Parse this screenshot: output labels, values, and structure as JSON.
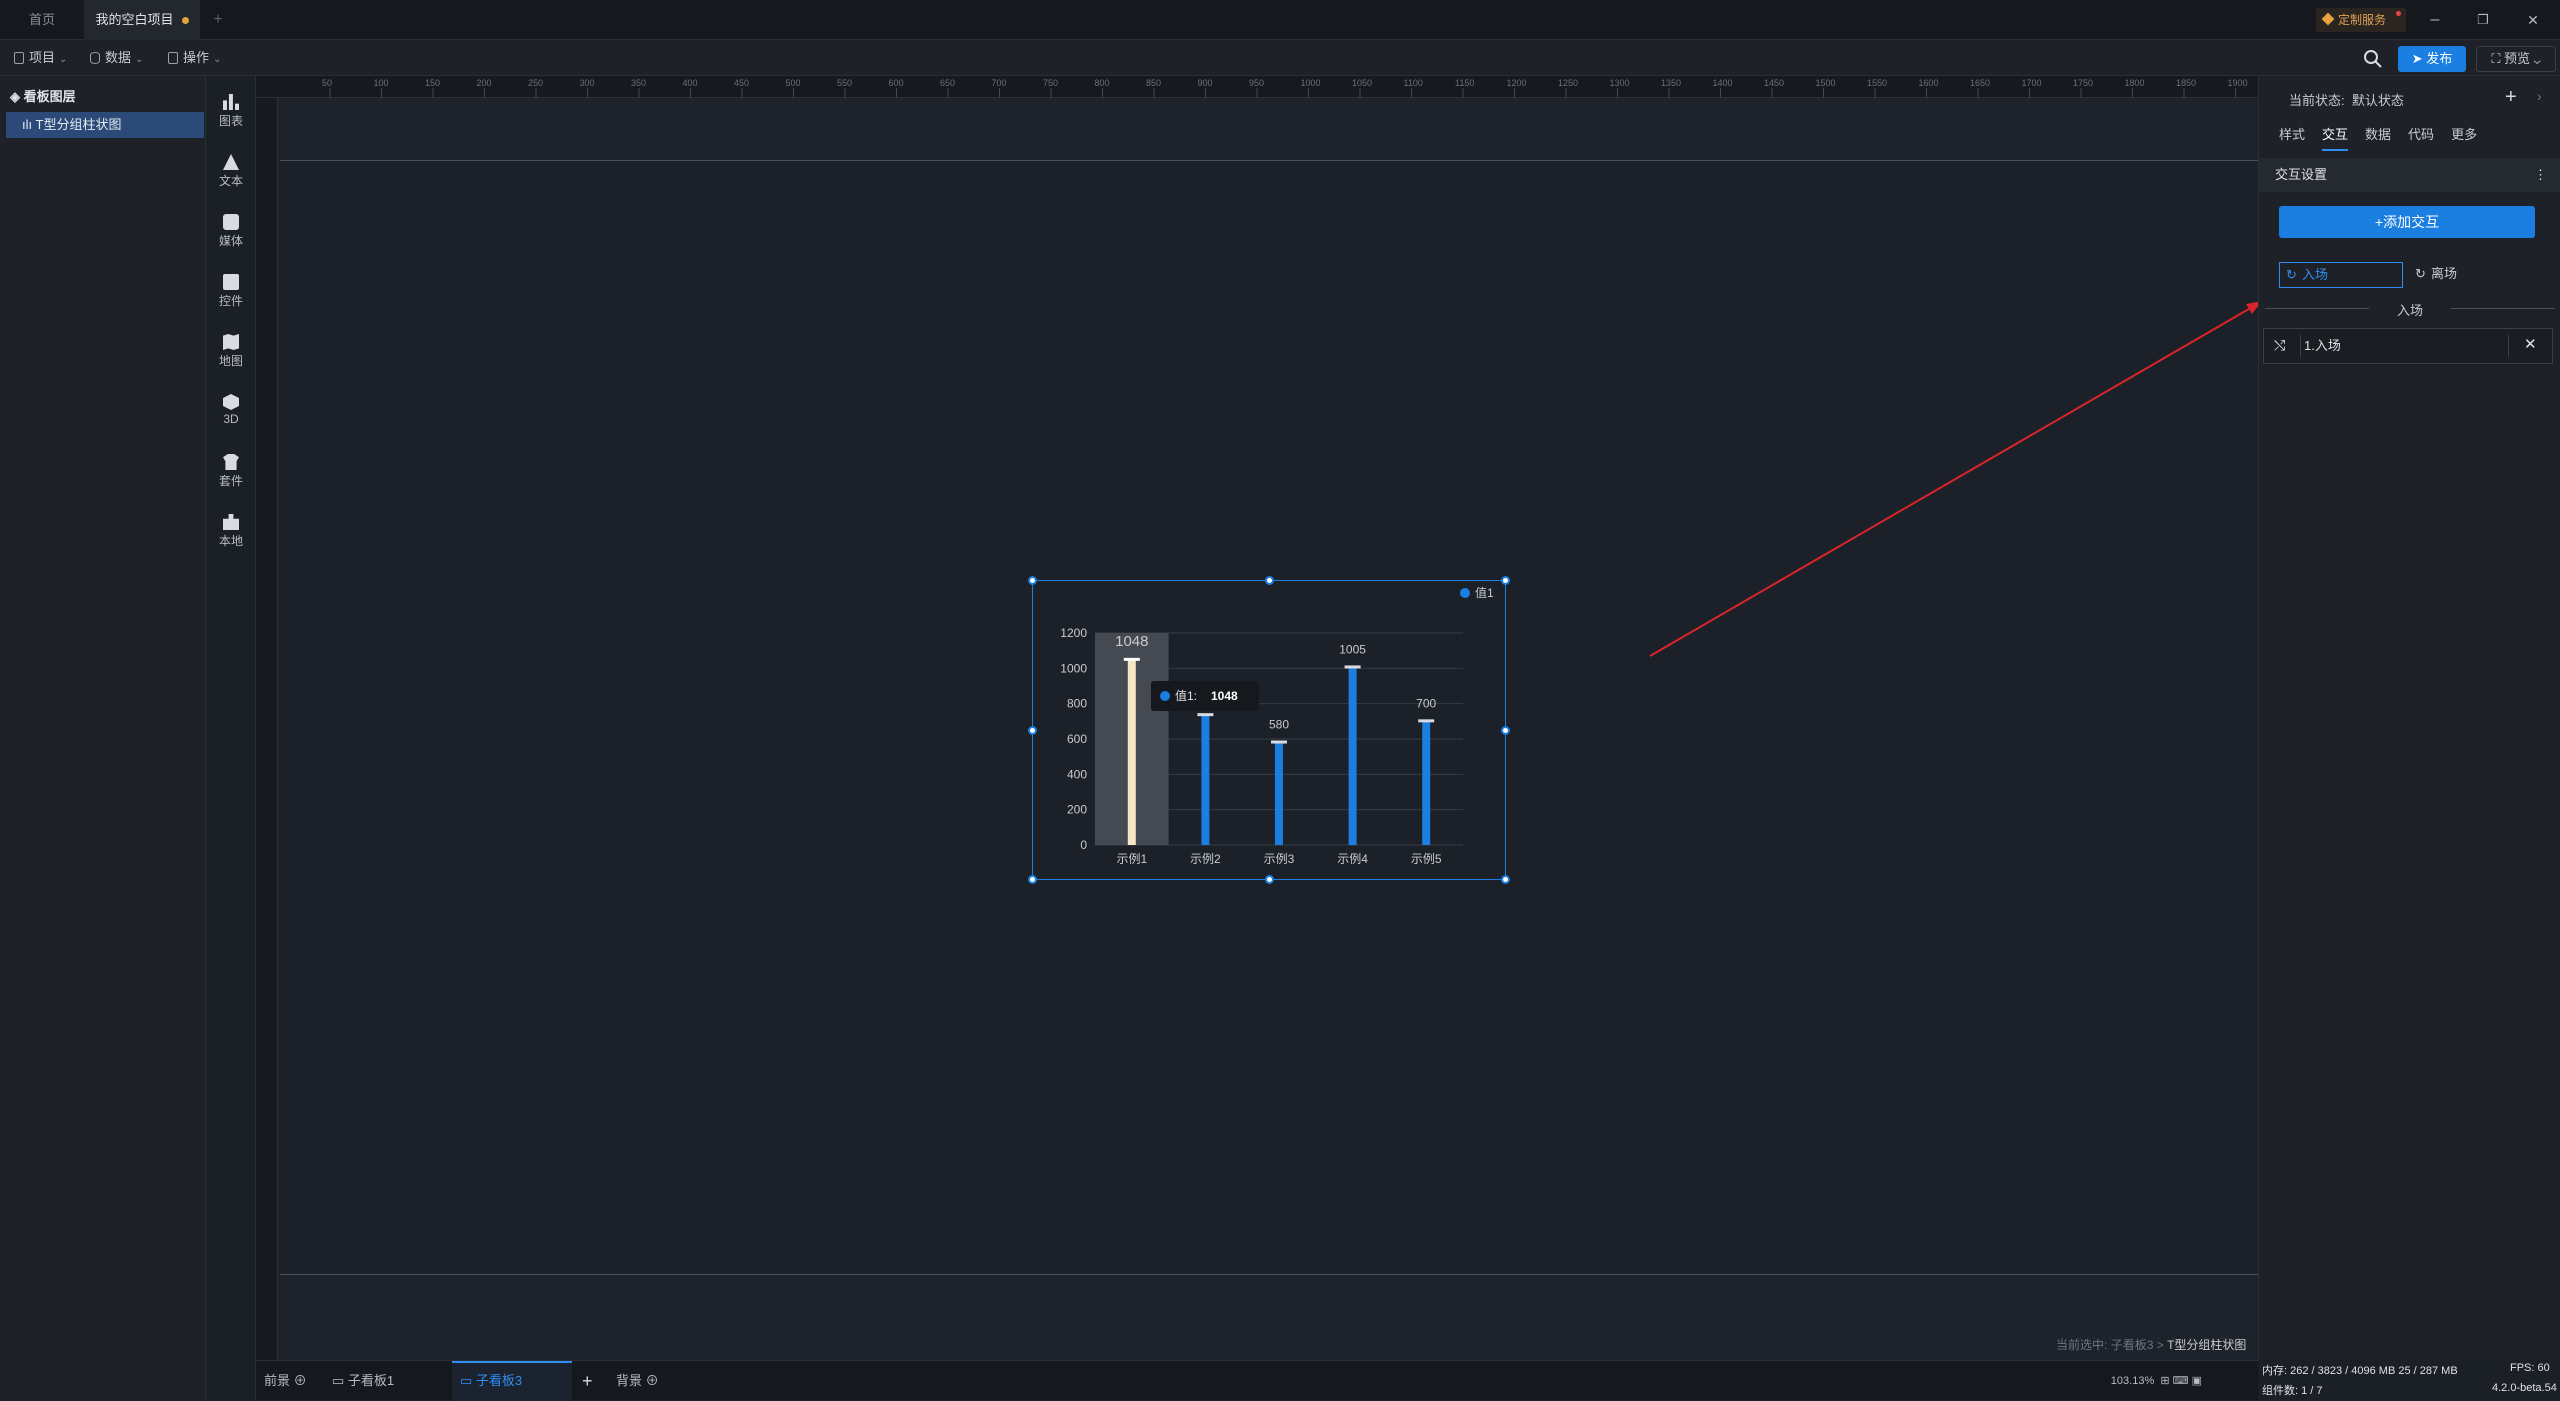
{
  "titlebar": {
    "tab_home": "首页",
    "tab_project": "我的空白项目",
    "tab_add": "+",
    "custom_service": "定制服务",
    "win_min": "–",
    "win_restore": "❐",
    "win_close": "✕"
  },
  "menubar": {
    "project": "项目",
    "data": "数据",
    "operate": "操作",
    "publish": "发布",
    "preview": "预览"
  },
  "layers": {
    "title": "看板图层",
    "items": [
      {
        "label": "T型分组柱状图"
      }
    ]
  },
  "components": [
    {
      "label": "图表",
      "icon": "bar-chart-icon"
    },
    {
      "label": "文本",
      "icon": "text-icon"
    },
    {
      "label": "媒体",
      "icon": "media-icon"
    },
    {
      "label": "控件",
      "icon": "control-icon"
    },
    {
      "label": "地图",
      "icon": "map-icon"
    },
    {
      "label": "3D",
      "icon": "cube-icon"
    },
    {
      "label": "套件",
      "icon": "kit-icon"
    },
    {
      "label": "本地",
      "icon": "puzzle-icon"
    }
  ],
  "ruler": {
    "top_ticks": [
      "50",
      "100",
      "150",
      "200",
      "250",
      "300",
      "350",
      "400",
      "450",
      "500",
      "550",
      "600",
      "650",
      "700",
      "750",
      "800",
      "850",
      "900",
      "950",
      "1000",
      "1050",
      "1100",
      "1150",
      "1200",
      "1250",
      "1300",
      "1350",
      "1400",
      "1450",
      "1500",
      "1550",
      "1600",
      "1650",
      "1700",
      "1750",
      "1800",
      "1850",
      "1900"
    ]
  },
  "chart_data": {
    "type": "bar",
    "categories": [
      "示例1",
      "示例2",
      "示例3",
      "示例4",
      "示例5"
    ],
    "series": [
      {
        "name": "值1",
        "values": [
          1048,
          735,
          580,
          1005,
          700
        ]
      }
    ],
    "data_labels": [
      "1048",
      "",
      "580",
      "1005",
      "700"
    ],
    "yticks": [
      "0",
      "200",
      "400",
      "600",
      "800",
      "1000",
      "1200"
    ],
    "ylim": [
      0,
      1200
    ],
    "highlight_index": 0,
    "bar_color": "#1a7fe0",
    "highlight_color": "#f5e6c4",
    "tooltip": {
      "label": "值1:",
      "value": "1048"
    },
    "legend_position": "top-right"
  },
  "bottombar": {
    "foreground": "前景",
    "sub1": "子看板1",
    "sub3": "子看板3",
    "add": "+",
    "background": "背景",
    "zoom": "103.13%"
  },
  "breadcrumb": {
    "prefix": "当前选中:",
    "path1": "子看板3",
    "sep": ">",
    "path2": "T型分组柱状图"
  },
  "rpanel": {
    "state_label": "当前状态:",
    "state_value": "默认状态",
    "tabs": [
      "样式",
      "交互",
      "数据",
      "代码",
      "更多"
    ],
    "active_tab": 1,
    "section_title": "交互设置",
    "add_interaction": "+添加交互",
    "trigger_enter": "入场",
    "trigger_leave": "离场",
    "divider": "入场",
    "entry": "1.入场"
  },
  "status": {
    "memory": "内存: 262 / 3823 / 4096 MB  25 / 287 MB",
    "fps": "FPS: 60",
    "count": "组件数: 1 / 7",
    "version": "4.2.0-beta.54"
  },
  "colors": {
    "accent": "#1a7fe0",
    "arrow": "#d9242a"
  }
}
